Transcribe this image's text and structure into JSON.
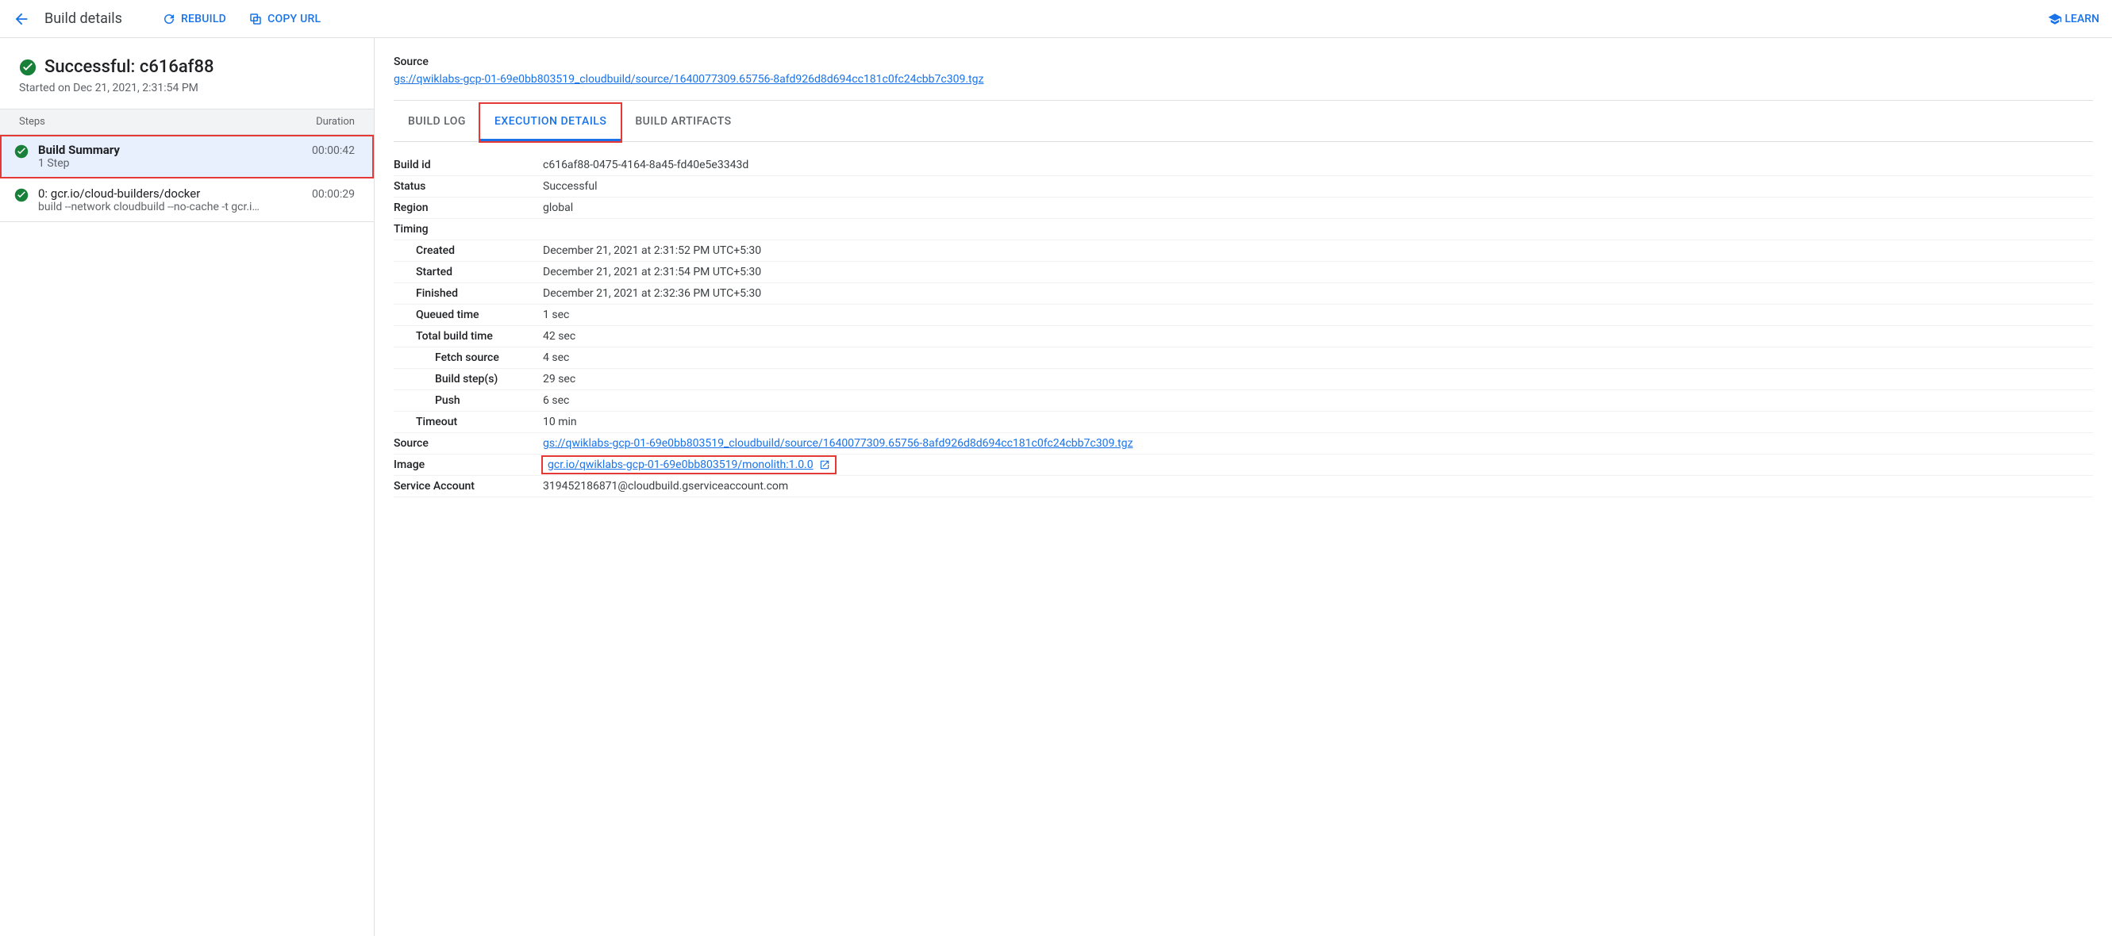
{
  "header": {
    "title": "Build details",
    "rebuild": "REBUILD",
    "copy_url": "COPY URL",
    "learn": "LEARN"
  },
  "build": {
    "status_title": "Successful: c616af88",
    "started_on": "Started on Dec 21, 2021, 2:31:54 PM"
  },
  "steps_header": {
    "label": "Steps",
    "duration": "Duration"
  },
  "steps": [
    {
      "title": "Build Summary",
      "sub": "1 Step",
      "duration": "00:00:42",
      "bold": true,
      "selected": true,
      "highlight": true
    },
    {
      "title": "0: gcr.io/cloud-builders/docker",
      "sub": "build --network cloudbuild --no-cache -t gcr.i…",
      "duration": "00:00:29",
      "bold": false,
      "selected": false,
      "highlight": false
    }
  ],
  "source_header": {
    "label": "Source",
    "link": "gs://qwiklabs-gcp-01-69e0bb803519_cloudbuild/source/1640077309.65756-8afd926d8d694cc181c0fc24cbb7c309.tgz"
  },
  "tabs": {
    "build_log": "BUILD LOG",
    "execution_details": "EXECUTION DETAILS",
    "build_artifacts": "BUILD ARTIFACTS"
  },
  "details": {
    "build_id": {
      "label": "Build id",
      "value": "c616af88-0475-4164-8a45-fd40e5e3343d"
    },
    "status": {
      "label": "Status",
      "value": "Successful"
    },
    "region": {
      "label": "Region",
      "value": "global"
    },
    "timing": {
      "label": "Timing"
    },
    "created": {
      "label": "Created",
      "value": "December 21, 2021 at 2:31:52 PM UTC+5:30"
    },
    "started": {
      "label": "Started",
      "value": "December 21, 2021 at 2:31:54 PM UTC+5:30"
    },
    "finished": {
      "label": "Finished",
      "value": "December 21, 2021 at 2:32:36 PM UTC+5:30"
    },
    "queued": {
      "label": "Queued time",
      "value": "1 sec"
    },
    "total": {
      "label": "Total build time",
      "value": "42 sec"
    },
    "fetch": {
      "label": "Fetch source",
      "value": "4 sec"
    },
    "buildsteps": {
      "label": "Build step(s)",
      "value": "29 sec"
    },
    "push": {
      "label": "Push",
      "value": "6 sec"
    },
    "timeout": {
      "label": "Timeout",
      "value": "10 min"
    },
    "source": {
      "label": "Source",
      "value": "gs://qwiklabs-gcp-01-69e0bb803519_cloudbuild/source/1640077309.65756-8afd926d8d694cc181c0fc24cbb7c309.tgz"
    },
    "image": {
      "label": "Image",
      "value": "gcr.io/qwiklabs-gcp-01-69e0bb803519/monolith:1.0.0"
    },
    "service_account": {
      "label": "Service Account",
      "value": "319452186871@cloudbuild.gserviceaccount.com"
    }
  }
}
